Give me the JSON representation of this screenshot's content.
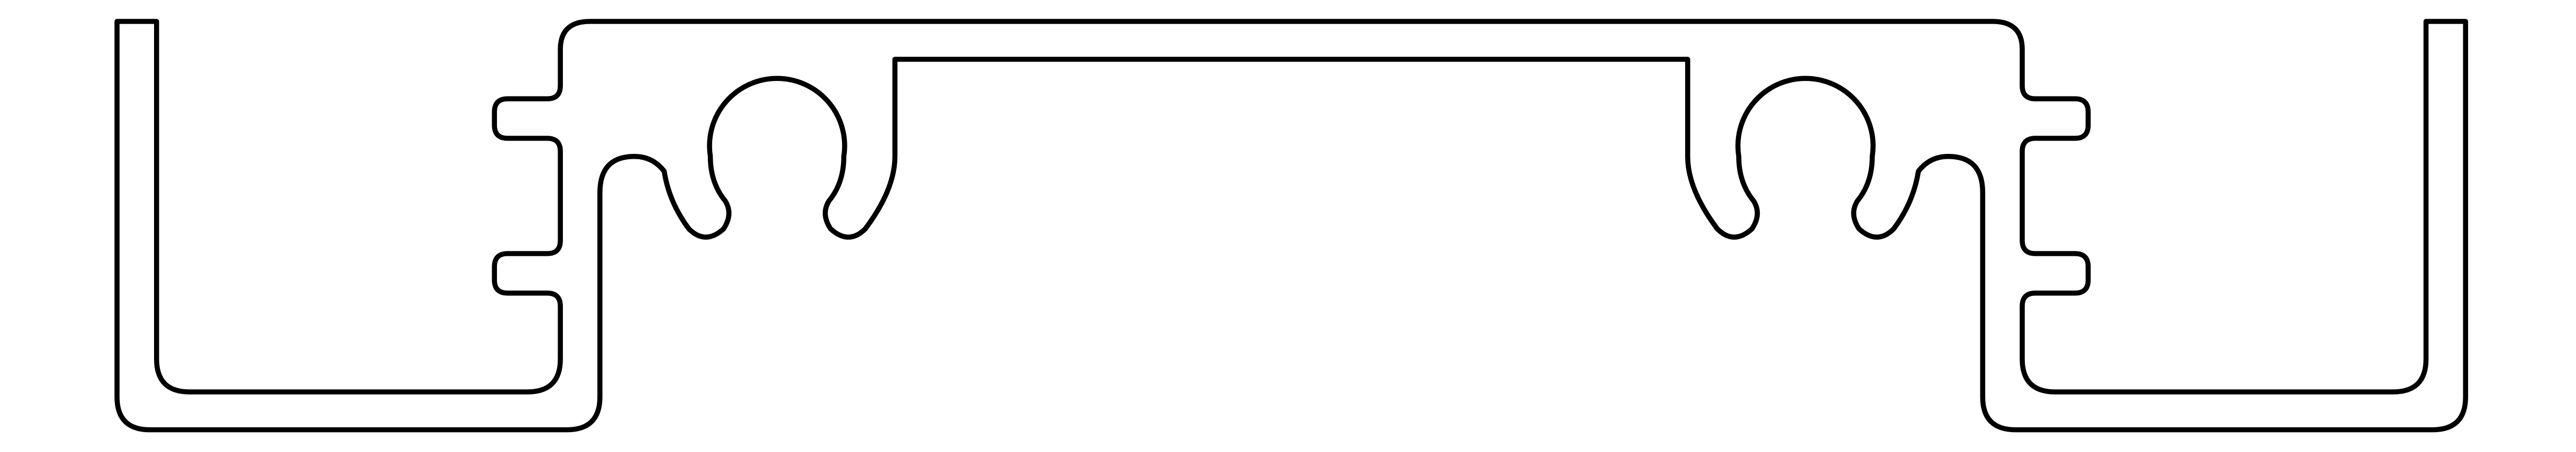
{
  "drawing": {
    "kind": "extrusion-profile-cross-section",
    "background_color": "#ffffff",
    "line_color": "#000000",
    "text_labels": []
  }
}
